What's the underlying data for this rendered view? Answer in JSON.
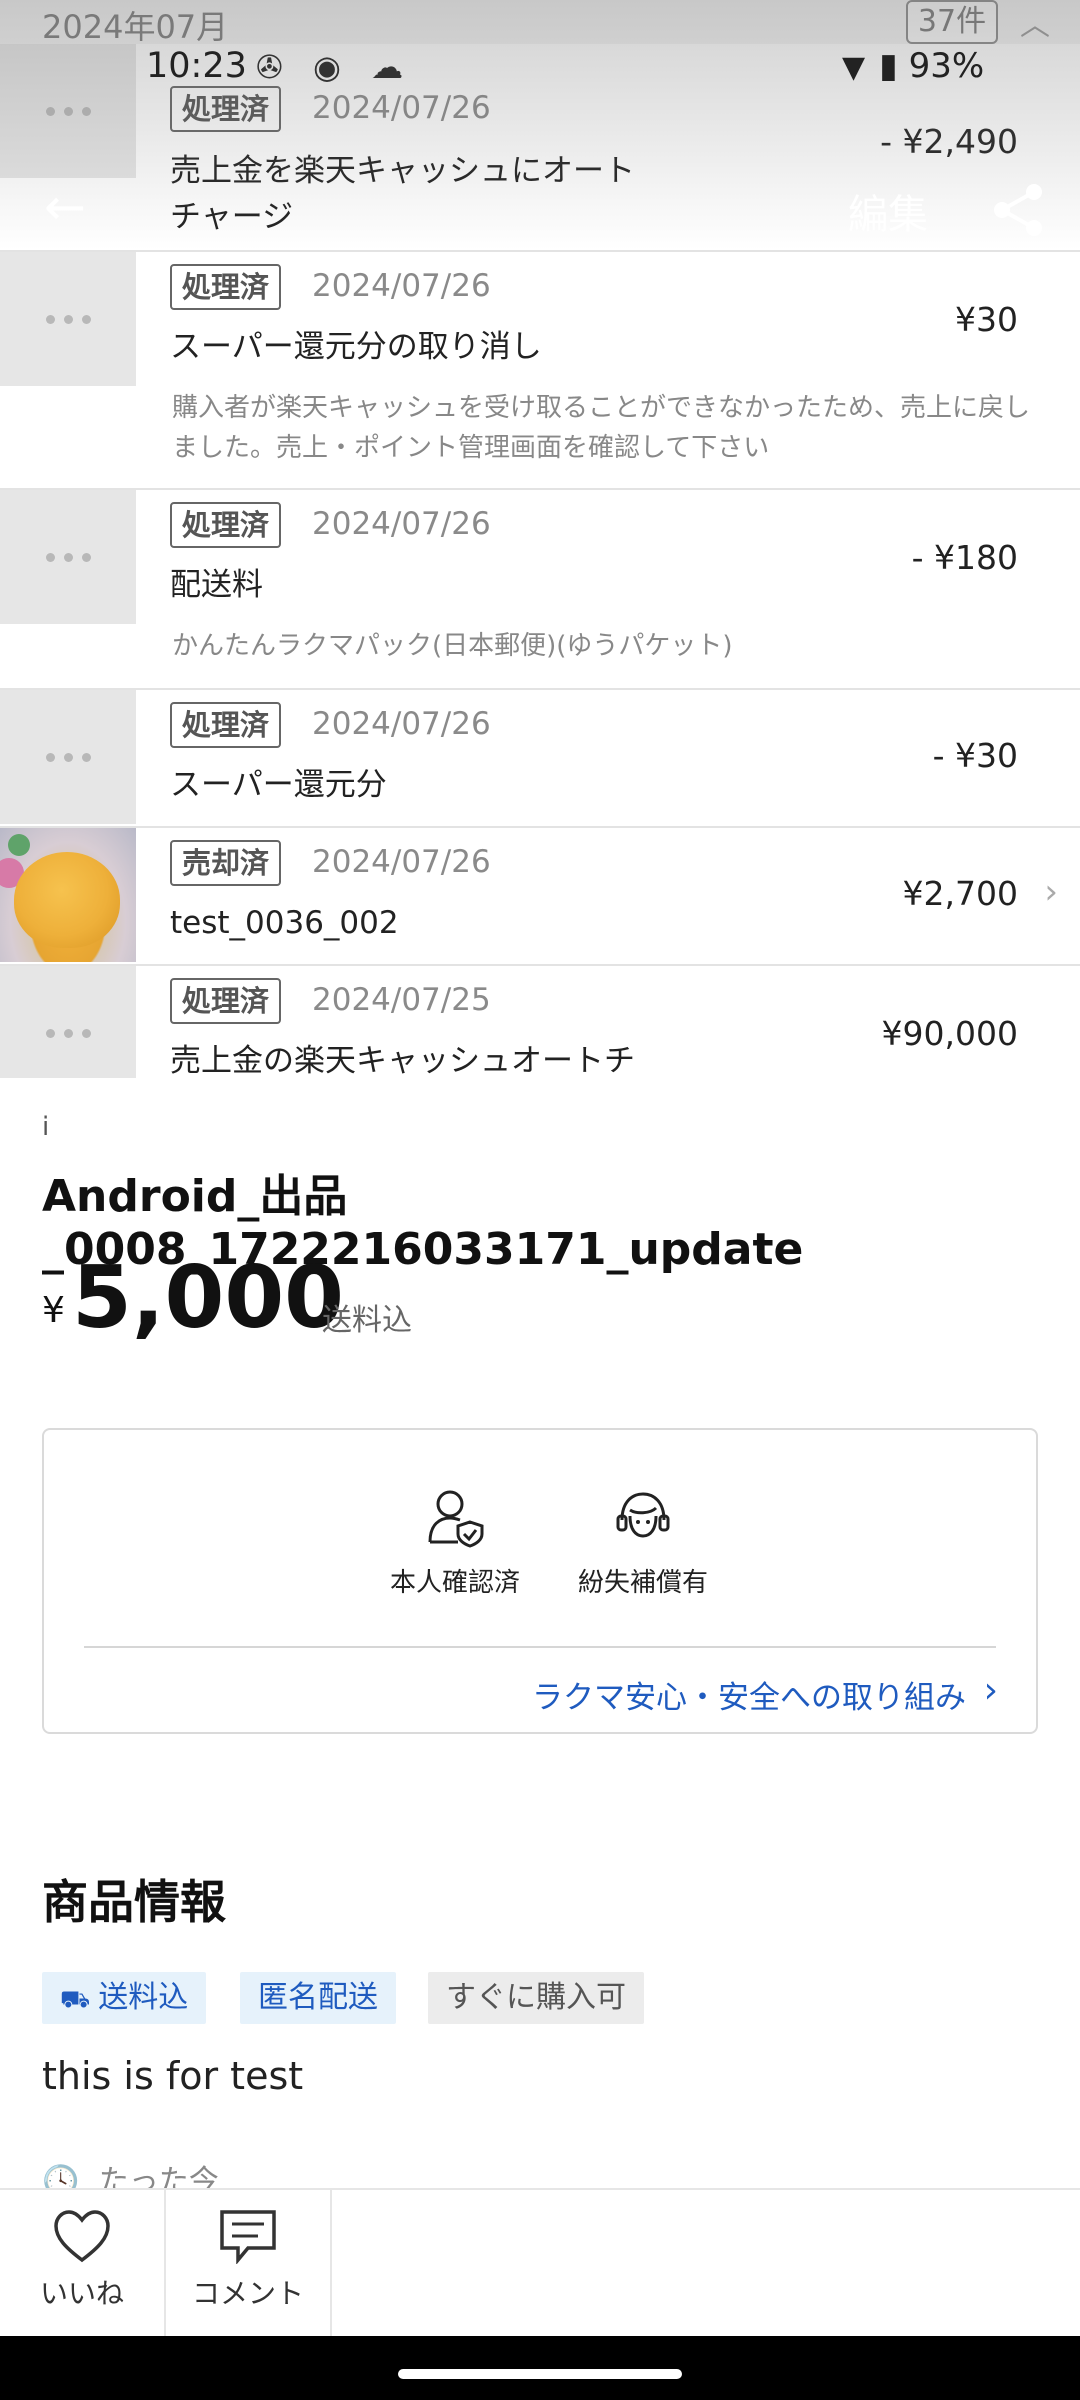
{
  "status_bar": {
    "time": "10:23",
    "left_icons": "✇ ◉ ☁",
    "battery": "93%"
  },
  "app_bar": {
    "edit_label": "編集"
  },
  "history": {
    "month": "2024年07月",
    "count": "37件",
    "rows": [
      {
        "status": "処理済",
        "date": "2024/07/26",
        "title": "売上金を楽天キャッシュにオートチャージ",
        "amount": "- ¥2,490",
        "note": ""
      },
      {
        "status": "処理済",
        "date": "2024/07/26",
        "title": "スーパー還元分の取り消し",
        "amount": "¥30",
        "note": "購入者が楽天キャッシュを受け取ることができなかったため、売上に戻しました。売上・ポイント管理画面を確認して下さい"
      },
      {
        "status": "処理済",
        "date": "2024/07/26",
        "title": "配送料",
        "amount": "- ¥180",
        "note": "かんたんラクマパック(日本郵便)(ゆうパケット)"
      },
      {
        "status": "処理済",
        "date": "2024/07/26",
        "title": "スーパー還元分",
        "amount": "- ¥30",
        "note": ""
      },
      {
        "status": "売却済",
        "date": "2024/07/26",
        "title": "test_0036_002",
        "amount": "¥2,700",
        "note": ""
      },
      {
        "status": "処理済",
        "date": "2024/07/25",
        "title": "売上金の楽天キャッシュオートチ",
        "amount": "¥90,000",
        "note": ""
      }
    ]
  },
  "product": {
    "info_mark": "i",
    "title": "Android_出品_0008_1722216033171_update",
    "price_symbol": "¥",
    "price": "5,000",
    "price_note": "送料込"
  },
  "safety": {
    "badges": [
      "本人確認済",
      "紛失補償有"
    ],
    "link": "ラクマ安心・安全への取り組み"
  },
  "info": {
    "section_title": "商品情報",
    "tags": [
      "送料込",
      "匿名配送",
      "すぐに購入可"
    ],
    "description": "this is for test",
    "time": "たった今"
  },
  "bottom": {
    "like": "いいね",
    "comment": "コメント"
  },
  "colors": {
    "link": "#1f5bbf",
    "tag_blue_bg": "#e6f2fb"
  }
}
